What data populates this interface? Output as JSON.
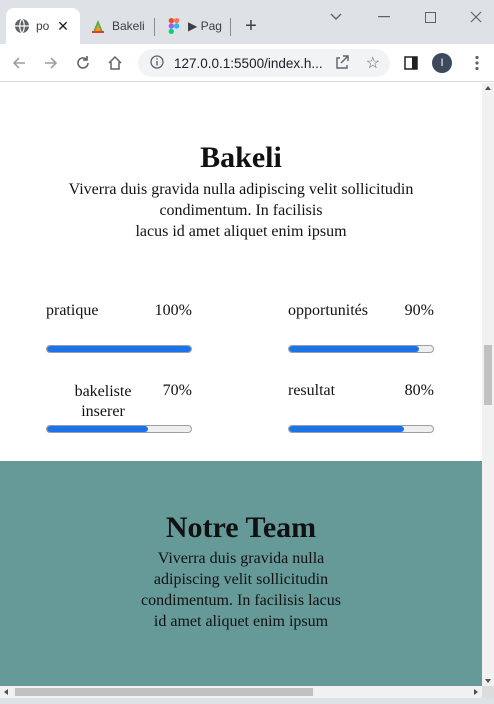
{
  "browser": {
    "tabs": [
      {
        "label": "po",
        "active": true,
        "icon": "globe-icon"
      },
      {
        "label": "Bakeli",
        "active": false,
        "icon": "bakeli-favicon"
      },
      {
        "label": "▶ Pag",
        "active": false,
        "icon": "figma-icon"
      }
    ],
    "new_tab": "+",
    "url": "127.0.0.1:5500/index.h...",
    "profile_initial": "I"
  },
  "page": {
    "bakeli": {
      "title": "Bakeli",
      "text_line1": "Viverra duis gravida nulla adipiscing velit sollicitudin",
      "text_line2": "condimentum. In facilisis",
      "text_line3": "lacus id amet aliquet enim ipsum"
    },
    "skills": [
      {
        "name": "pratique",
        "percent_label": "100%",
        "value": 100
      },
      {
        "name": "opportunités",
        "percent_label": "90%",
        "value": 90
      },
      {
        "name": "bakeliste inserer",
        "percent_label": "70%",
        "value": 70
      },
      {
        "name": "resultat",
        "percent_label": "80%",
        "value": 80
      }
    ],
    "team": {
      "title": "Notre Team",
      "text": "Viverra duis gravida nulla adipiscing velit sollicitudin condimentum. In facilisis lacus id amet aliquet enim ipsum"
    }
  },
  "colors": {
    "progress_fill": "#1a73e8",
    "team_background": "#659a99"
  }
}
